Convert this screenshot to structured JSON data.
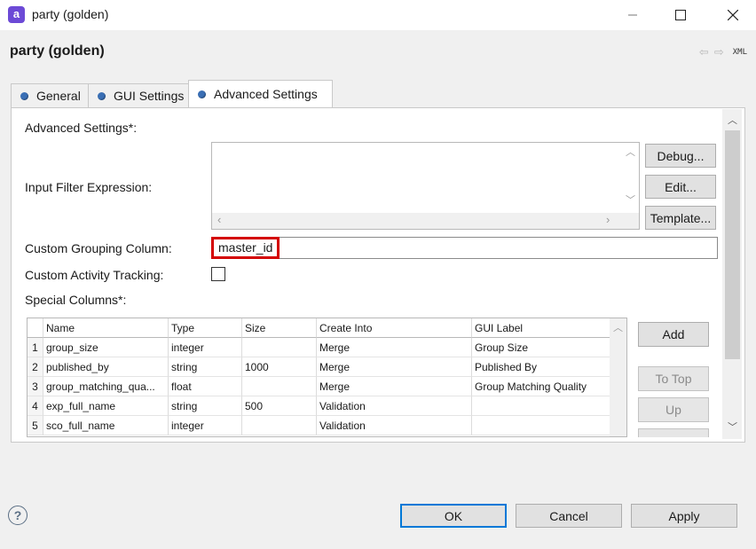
{
  "window": {
    "title": "party (golden)",
    "app_icon_letter": "a"
  },
  "header": {
    "title": "party (golden)",
    "xml_label": "XML"
  },
  "tabs": [
    {
      "label": "General"
    },
    {
      "label": "GUI Settings"
    },
    {
      "label": "Advanced Settings"
    }
  ],
  "form": {
    "advanced_settings_label": "Advanced Settings*:",
    "input_filter_label": "Input Filter Expression:",
    "input_filter_value": "",
    "debug_button": "Debug...",
    "edit_button": "Edit...",
    "template_button": "Template...",
    "custom_grouping_label": "Custom Grouping Column:",
    "custom_grouping_value": "master_id",
    "custom_activity_label": "Custom Activity Tracking:",
    "custom_activity_checked": false,
    "special_columns_label": "Special Columns*:"
  },
  "table": {
    "headers": [
      "Name",
      "Type",
      "Size",
      "Create Into",
      "GUI Label"
    ],
    "rows": [
      {
        "num": "1",
        "name": "group_size",
        "type": "integer",
        "size": "",
        "create_into": "Merge",
        "gui_label": "Group Size"
      },
      {
        "num": "2",
        "name": "published_by",
        "type": "string",
        "size": "1000",
        "create_into": "Merge",
        "gui_label": "Published By"
      },
      {
        "num": "3",
        "name": "group_matching_qua...",
        "type": "float",
        "size": "",
        "create_into": "Merge",
        "gui_label": "Group Matching Quality"
      },
      {
        "num": "4",
        "name": "exp_full_name",
        "type": "string",
        "size": "500",
        "create_into": "Validation",
        "gui_label": ""
      },
      {
        "num": "5",
        "name": "sco_full_name",
        "type": "integer",
        "size": "",
        "create_into": "Validation",
        "gui_label": ""
      }
    ]
  },
  "side_buttons": {
    "add": "Add",
    "to_top": "To Top",
    "up": "Up"
  },
  "footer": {
    "ok": "OK",
    "cancel": "Cancel",
    "apply": "Apply",
    "help_glyph": "?"
  },
  "colors": {
    "accent": "#0078d7",
    "highlight_border": "#d40000",
    "tab_dot": "#3a6fb5",
    "app_icon": "#6c4ad6"
  }
}
